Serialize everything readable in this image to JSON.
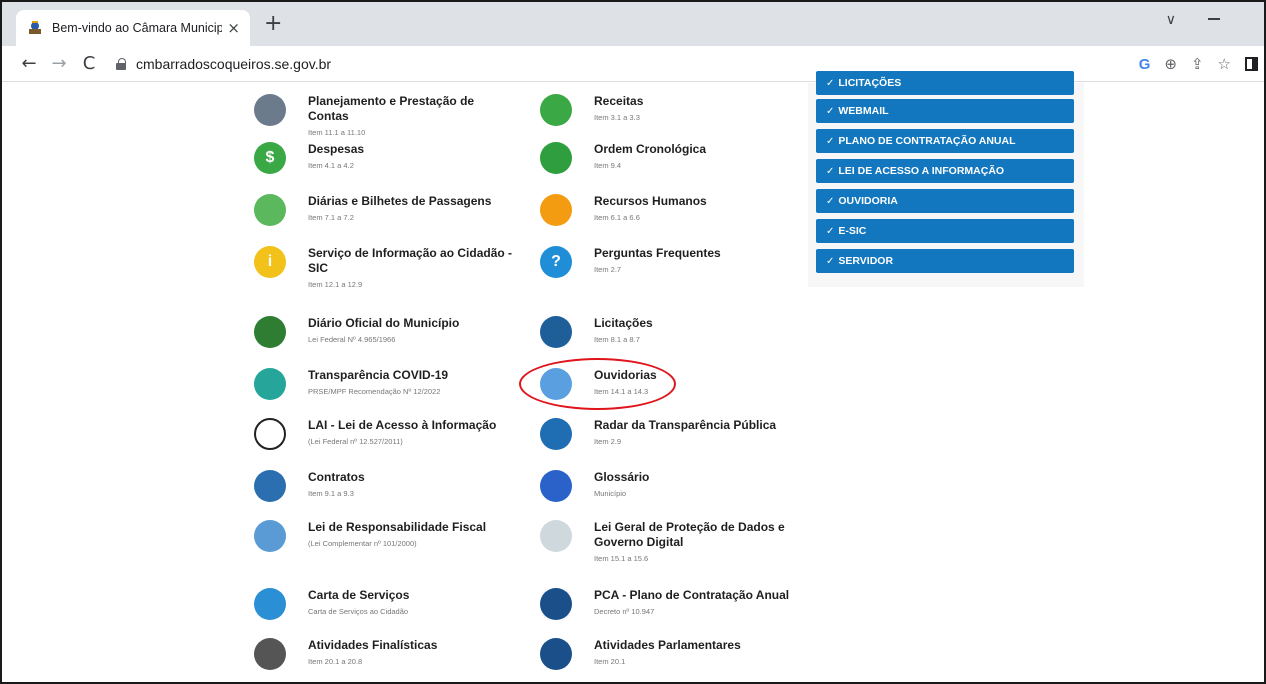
{
  "browser": {
    "tab_title": "Bem-vindo ao Câmara Municipal",
    "tab_close": "×",
    "new_tab": "+",
    "tab_search": "∨",
    "url": "cmbarradoscoqueiros.se.gov.br",
    "back": "←",
    "forward": "→",
    "reload": "C",
    "google": "G",
    "zoom": "⊕",
    "share": "⇪",
    "bookmark": "☆"
  },
  "left_column": [
    {
      "title": "Planejamento e Prestação de Contas",
      "sub": "Item 11.1 a 11.10",
      "icon": "chart-person-icon",
      "color": "#6b7b8c"
    },
    {
      "title": "Despesas",
      "sub": "Item 4.1 a 4.2",
      "icon": "dollar-icon",
      "color": "#3aa845"
    },
    {
      "title": "Diárias e Bilhetes de Passagens",
      "sub": "Item 7.1 a 7.2",
      "icon": "ticket-icon",
      "color": "#5cb85c"
    },
    {
      "title": "Serviço de Informação ao Cidadão - SIC",
      "sub": "Item 12.1 a 12.9",
      "icon": "info-icon",
      "color": "#f2c21b"
    },
    {
      "title": "Diário Oficial do Município",
      "sub": "Lei Federal Nº 4.965/1966",
      "icon": "coat-of-arms-icon",
      "color": "#2e7d32"
    },
    {
      "title": "Transparência COVID-19",
      "sub": "PRSE/MPF Recomendação Nº 12/2022",
      "icon": "virus-icon",
      "color": "#26a69a"
    },
    {
      "title": "LAI - Lei de Acesso à Informação",
      "sub": "(Lei Federal nº 12.527/2011)",
      "icon": "scales-icon",
      "color": "#ffffff"
    },
    {
      "title": "Contratos",
      "sub": "Item 9.1 a 9.3",
      "icon": "document-icon",
      "color": "#2b6fb0"
    },
    {
      "title": "Lei de Responsabilidade Fiscal",
      "sub": "(Lei Complementar nº 101/2000)",
      "icon": "bar-chart-icon",
      "color": "#5a9bd5"
    },
    {
      "title": "Carta de Serviços",
      "sub": "Carta de Serviços ao Cidadão",
      "icon": "folder-icon",
      "color": "#2b8fd6"
    },
    {
      "title": "Atividades Finalísticas",
      "sub": "Item 20.1 a 20.8",
      "icon": "checklist-icon",
      "color": "#555555"
    }
  ],
  "mid_column": [
    {
      "title": "Receitas",
      "sub": "Item 3.1 a 3.3",
      "icon": "money-search-icon",
      "color": "#3aa845"
    },
    {
      "title": "Ordem Cronológica",
      "sub": "Item 9.4",
      "icon": "people-queue-icon",
      "color": "#2e9e3e"
    },
    {
      "title": "Recursos Humanos",
      "sub": "Item 6.1 a 6.6",
      "icon": "team-icon",
      "color": "#f39c12"
    },
    {
      "title": "Perguntas Frequentes",
      "sub": "Item 2.7",
      "icon": "question-icon",
      "color": "#1f8ed6"
    },
    {
      "title": "Licitações",
      "sub": "Item 8.1 a 8.7",
      "icon": "gavel-icon",
      "color": "#1e5f99"
    },
    {
      "title": "Ouvidorias",
      "sub": "Item 14.1 a 14.3",
      "icon": "megaphone-icon",
      "color": "#5aa0e0"
    },
    {
      "title": "Radar da Transparência Pública",
      "sub": "Item 2.9",
      "icon": "radar-icon",
      "color": "#1f6db3"
    },
    {
      "title": "Glossário",
      "sub": "Município",
      "icon": "book-icon",
      "color": "#2a62c9"
    },
    {
      "title": "Lei Geral de Proteção de Dados e Governo Digital",
      "sub": "Item 15.1 a 15.6",
      "icon": "lock-shield-icon",
      "color": "#cfd8dc"
    },
    {
      "title": "PCA - Plano de Contratação Anual",
      "sub": "Decreto nº 10.947",
      "icon": "hand-money-icon",
      "color": "#1b4f8a"
    },
    {
      "title": "Atividades Parlamentares",
      "sub": "Item 20.1",
      "icon": "meeting-icon",
      "color": "#1b4f8a"
    }
  ],
  "menu": [
    {
      "label": "LICITAÇÕES"
    },
    {
      "label": "WEBMAIL"
    },
    {
      "label": "PLANO DE CONTRATAÇÃO ANUAL"
    },
    {
      "label": "LEI DE ACESSO A INFORMAÇÃO"
    },
    {
      "label": "OUVIDORIA"
    },
    {
      "label": "E-SIC"
    },
    {
      "label": "SERVIDOR"
    }
  ],
  "glyphs": {
    "check": "✓",
    "dollar": "$",
    "info": "i",
    "question": "?"
  }
}
